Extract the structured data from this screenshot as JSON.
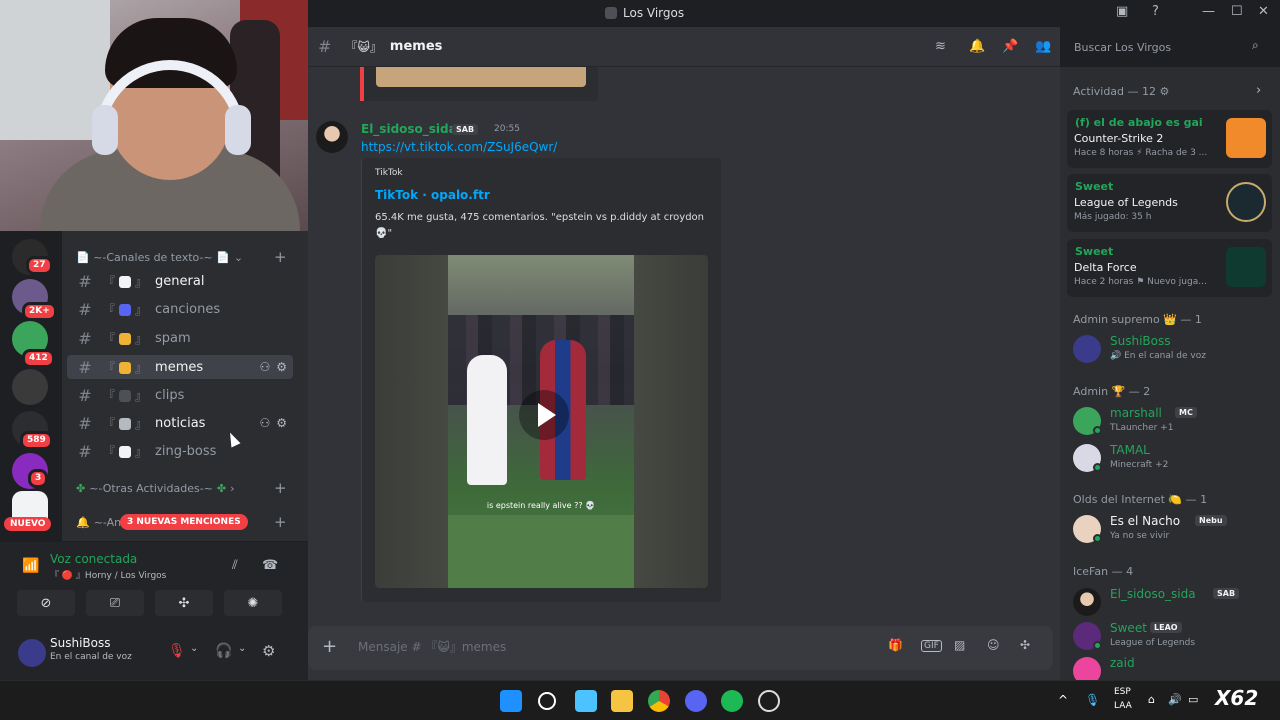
{
  "window": {
    "title": "Los Virgos"
  },
  "servers": {
    "badges": [
      "27",
      "2K+",
      "412",
      "589",
      "3"
    ],
    "nuevo": "NUEVO"
  },
  "sidebar": {
    "category_text": "📄 ~-Canales de texto-~ 📄",
    "channels": [
      {
        "name": "general"
      },
      {
        "name": "canciones"
      },
      {
        "name": "spam"
      },
      {
        "name": "memes"
      },
      {
        "name": "clips"
      },
      {
        "name": "noticias"
      },
      {
        "name": "zing-boss"
      }
    ],
    "category_other": "~-Otras Actividades-~",
    "category_third": "~-Anu",
    "mentions": "3 NUEVAS MENCIONES",
    "brackets": {
      "open": "『",
      "close": "』"
    }
  },
  "voice": {
    "status": "Voz conectada",
    "channel": "『 🔴 』Horny / Los Virgos"
  },
  "user": {
    "name": "SushiBoss",
    "status": "En el canal de voz"
  },
  "channel_header": {
    "hash": "#",
    "brackets": "『😺』",
    "name": "memes"
  },
  "search": {
    "placeholder": "Buscar Los Virgos"
  },
  "message": {
    "author": "El_sidoso_sida",
    "tag": "SAB",
    "time": "20:55",
    "link": "https://vt.tiktok.com/ZSuJ6eQwr/",
    "embed": {
      "provider": "TikTok",
      "title": "TikTok · opalo.ftr",
      "description": "65.4K me gusta, 475 comentarios. \"epstein vs p.diddy at croydon 💀\"",
      "caption": "is epstein really alive ?? 💀"
    }
  },
  "composer": {
    "placeholder": "Mensaje # 『😺』memes"
  },
  "members": {
    "activity_header": "Actividad — 12",
    "activities": [
      {
        "who": "(f) el de abajo es gai",
        "game": "Counter-Strike 2",
        "detail": "Hace 8 horas  ⚡ Racha de 3 ...",
        "color": "#f08a2a"
      },
      {
        "who": "Sweet",
        "game": "League of Legends",
        "detail": "Más jugado: 35 h",
        "color": "#c8aa6e"
      },
      {
        "who": "Sweet",
        "game": "Delta Force",
        "detail": "Hace 2 horas  ⚑ Nuevo juga...",
        "color": "#23c4a0"
      }
    ],
    "groups": [
      {
        "header": "Admin supremo 👑 — 1",
        "members": [
          {
            "name": "SushiBoss",
            "sub": "🔊 En el canal de voz",
            "color": "#23a55a",
            "tag": ""
          }
        ]
      },
      {
        "header": "Admin 🏆 — 2",
        "members": [
          {
            "name": "marshall",
            "sub": "TLauncher +1",
            "color": "#23a55a",
            "tag": "MC"
          },
          {
            "name": "TAMAL",
            "sub": "Minecraft +2",
            "color": "#23a55a",
            "tag": ""
          }
        ]
      },
      {
        "header": "Olds del Internet 🍋 — 1",
        "members": [
          {
            "name": "Es el Nacho",
            "sub": "Ya no se vivir",
            "color": "#f2f3f5",
            "tag": "Nebu"
          }
        ]
      },
      {
        "header": "IceFan — 4",
        "members": [
          {
            "name": "El_sidoso_sida",
            "sub": "",
            "color": "#23a55a",
            "tag": "SAB"
          },
          {
            "name": "Sweet",
            "sub": "League of Legends",
            "color": "#23a55a",
            "tag": "LEAO"
          },
          {
            "name": "zaid",
            "sub": "",
            "color": "#23a55a",
            "tag": ""
          }
        ]
      }
    ]
  },
  "taskbar": {
    "lang": "ESP",
    "lang2": "LAA"
  }
}
